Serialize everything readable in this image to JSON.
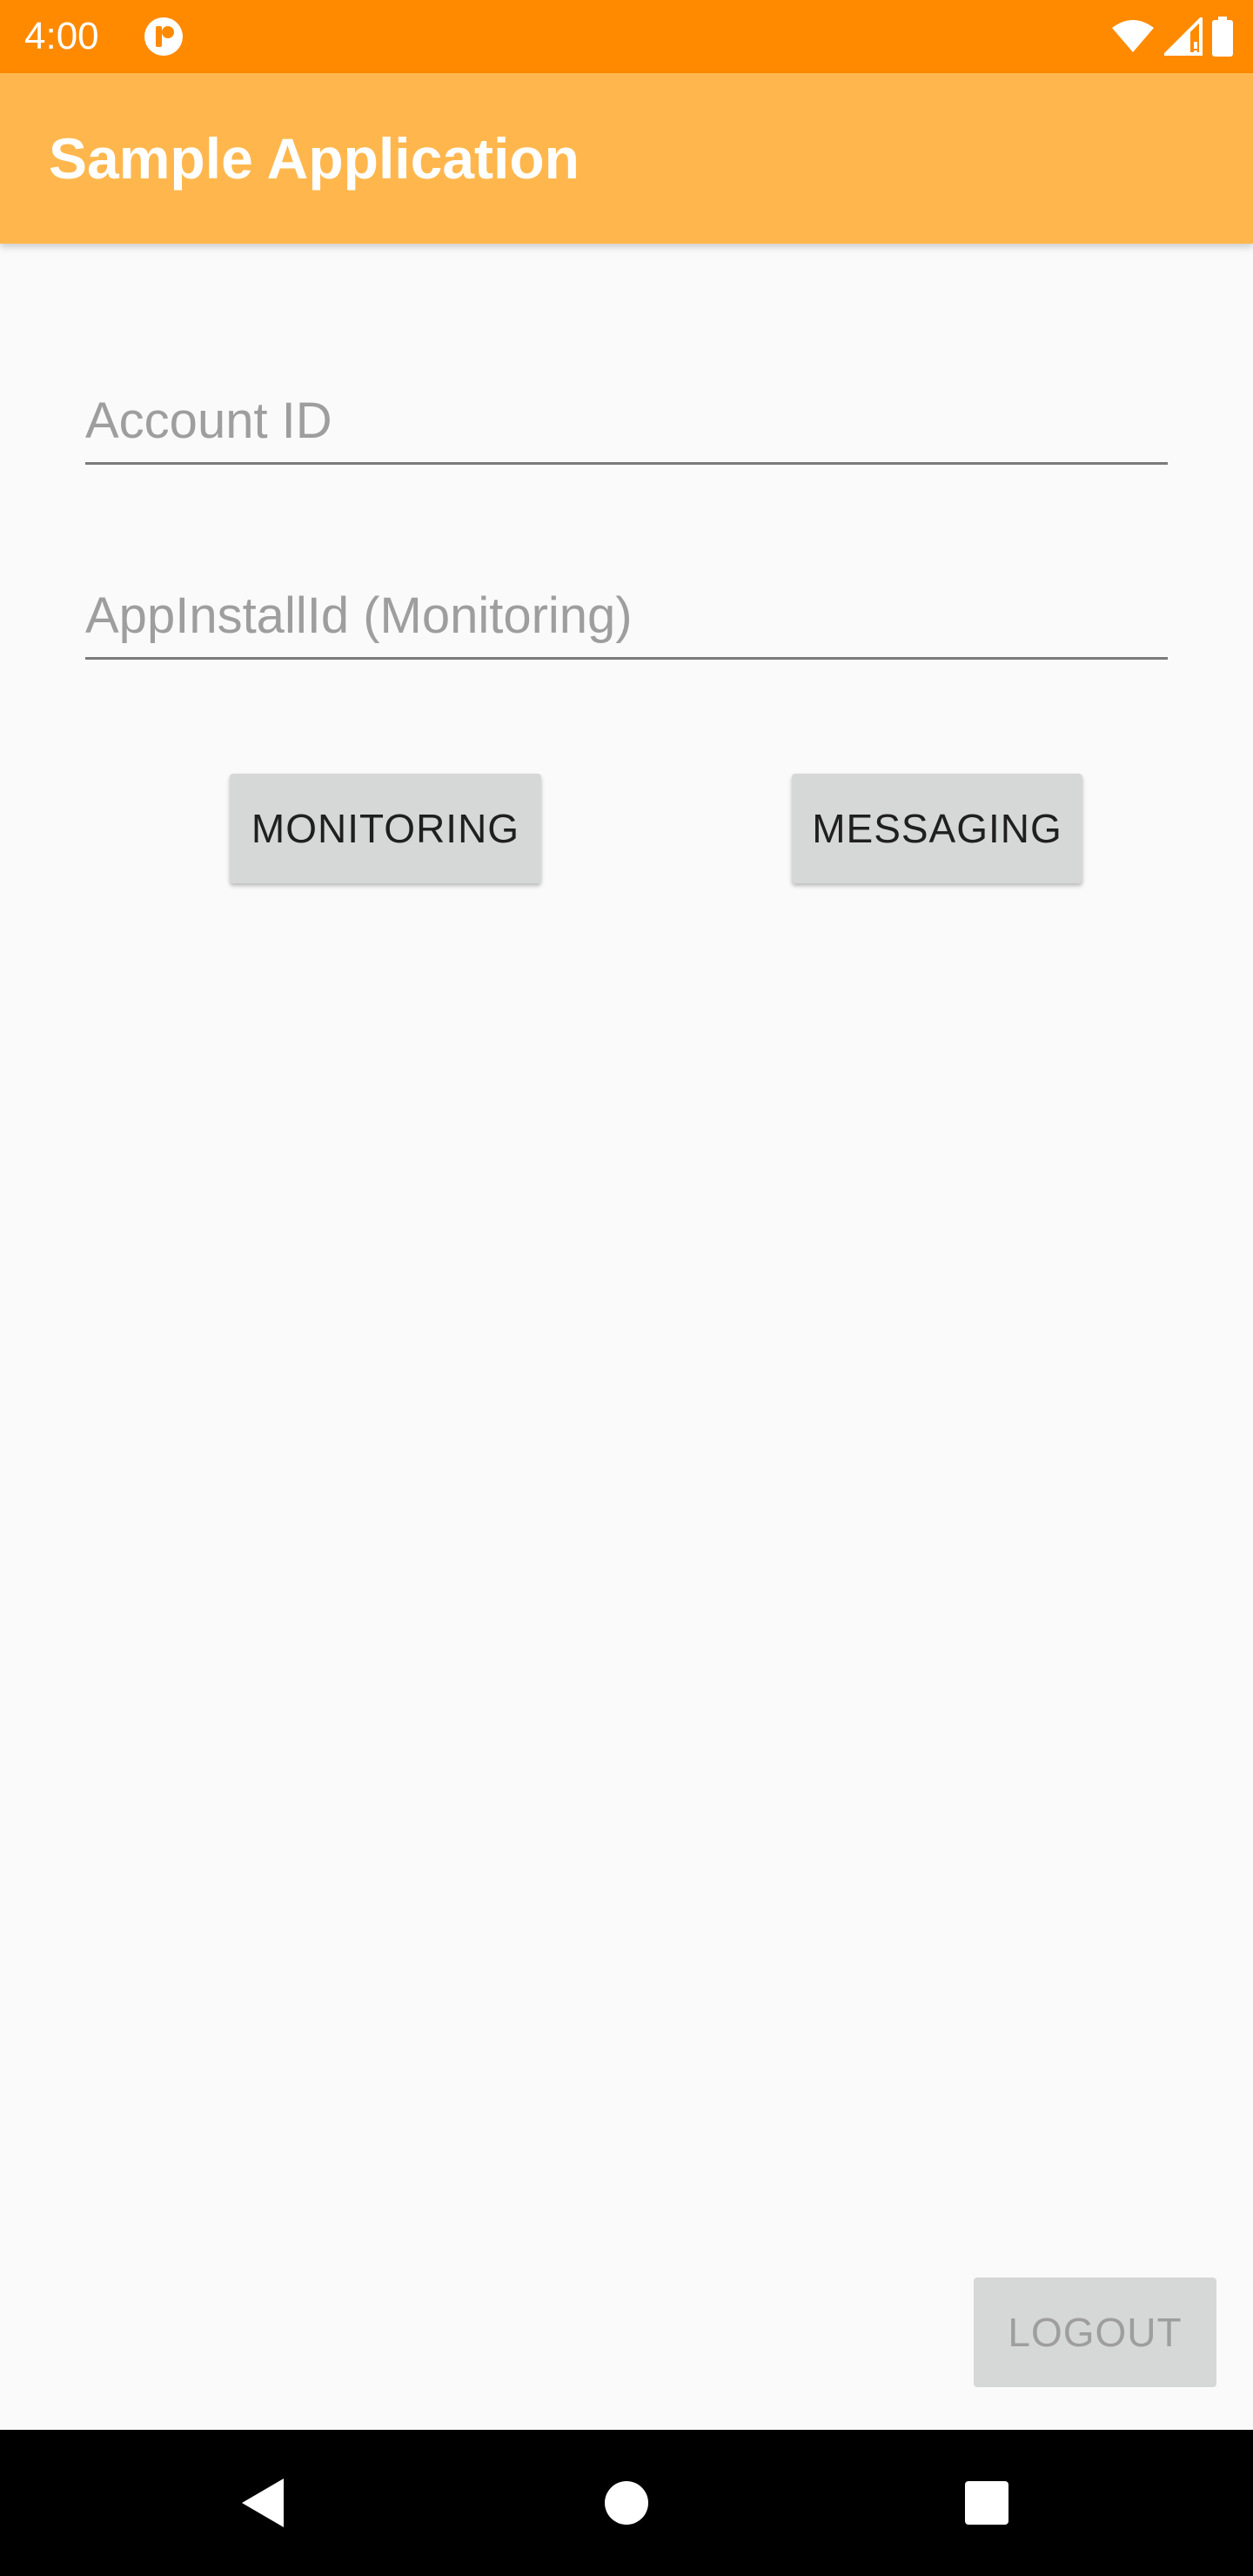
{
  "status_bar": {
    "time": "4:00",
    "icons": [
      "app-notification-icon",
      "wifi-icon",
      "cellular-signal-icon",
      "battery-icon"
    ],
    "background_color": "#ff8a00"
  },
  "app_bar": {
    "title": "Sample Application",
    "background_color": "#ffb74d"
  },
  "form": {
    "account_id": {
      "value": "",
      "placeholder": "Account ID"
    },
    "app_install_id": {
      "value": "",
      "placeholder": "AppInstallId (Monitoring)"
    }
  },
  "buttons": {
    "monitoring_label": "MONITORING",
    "messaging_label": "MESSAGING",
    "logout_label": "LOGOUT"
  },
  "nav_bar": {
    "icons": [
      "back-icon",
      "home-icon",
      "recents-icon"
    ]
  }
}
